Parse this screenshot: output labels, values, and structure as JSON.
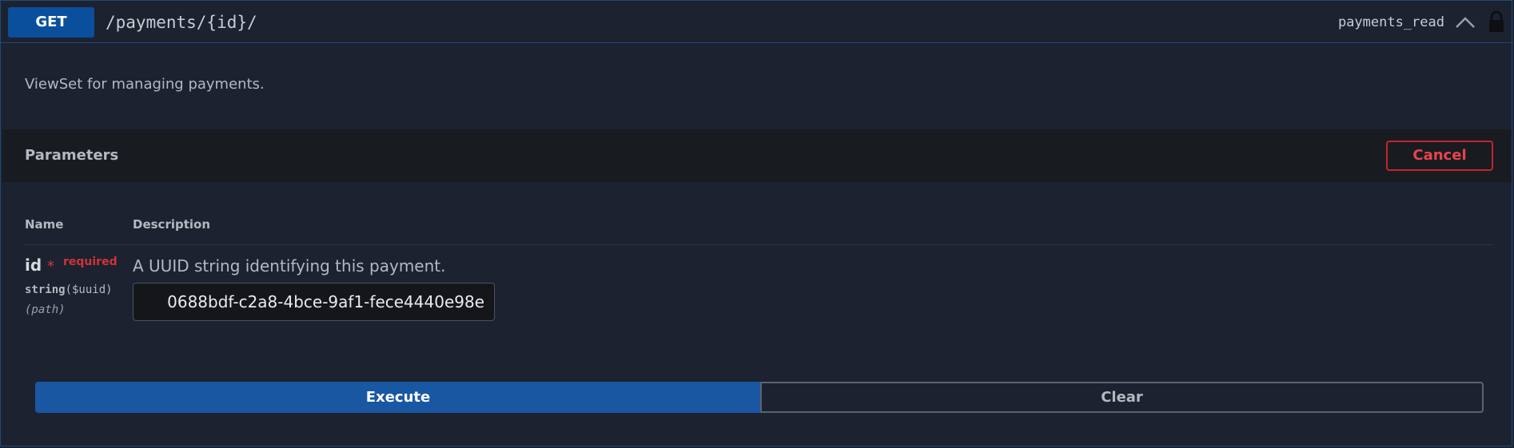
{
  "operation": {
    "method": "GET",
    "path": "/payments/{id}/",
    "operation_id": "payments_read",
    "description": "ViewSet for managing payments.",
    "method_color": "#0a4f9c"
  },
  "icons": {
    "collapse": "chevron-up-icon",
    "auth": "lock-icon"
  },
  "parameters": {
    "title": "Parameters",
    "cancel_label": "Cancel",
    "columns": {
      "name": "Name",
      "description": "Description"
    },
    "rows": [
      {
        "name": "id",
        "required_star": "*",
        "required_label": "required",
        "type": "string",
        "format": "($uuid)",
        "in": "(path)",
        "description": "A UUID string identifying this payment.",
        "value": "0688bdf-c2a8-4bce-9af1-fece4440e98e"
      }
    ]
  },
  "actions": {
    "execute_label": "Execute",
    "clear_label": "Clear"
  },
  "colors": {
    "background": "#1c2230",
    "accent": "#1a57a3",
    "danger": "#e8434d"
  }
}
